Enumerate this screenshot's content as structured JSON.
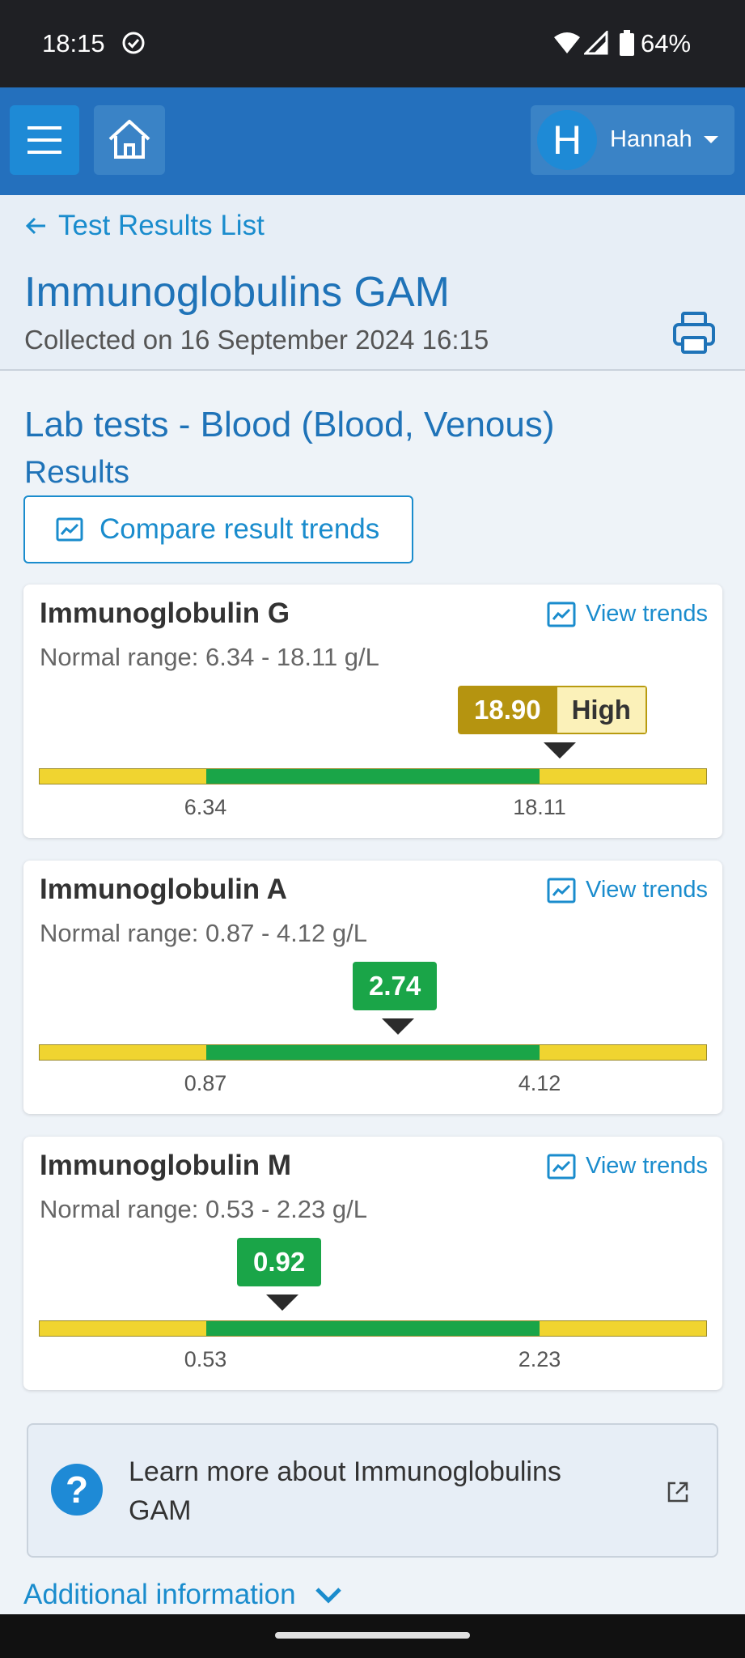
{
  "status_bar": {
    "time": "18:15",
    "battery": "64%"
  },
  "app_bar": {
    "user_initial": "H",
    "user_name": "Hannah"
  },
  "header": {
    "back_label": "Test Results List",
    "title": "Immunoglobulins GAM",
    "collected": "Collected on 16 September 2024 16:15"
  },
  "section": {
    "title": "Lab tests - Blood (Blood, Venous)",
    "subtitle": "Results",
    "compare_label": "Compare result trends"
  },
  "results": [
    {
      "name": "Immunoglobulin G",
      "trend_label": "View trends",
      "range": "Normal range: 6.34 - 18.11 g/L",
      "low": "6.34",
      "high": "18.11",
      "value": "18.90",
      "status": "High",
      "value_fraction": 0.78
    },
    {
      "name": "Immunoglobulin A",
      "trend_label": "View trends",
      "range": "Normal range: 0.87 - 4.12 g/L",
      "low": "0.87",
      "high": "4.12",
      "value": "2.74",
      "status": "",
      "value_fraction": 0.537
    },
    {
      "name": "Immunoglobulin M",
      "trend_label": "View trends",
      "range": "Normal range: 0.53 - 2.23 g/L",
      "low": "0.53",
      "high": "2.23",
      "value": "0.92",
      "status": "",
      "value_fraction": 0.364
    }
  ],
  "learn_more": {
    "text": "Learn more about Immunoglobulins GAM"
  },
  "additional_info_label": "Additional information",
  "colors": {
    "primary": "#2470bd",
    "link": "#1a8ccd",
    "normal": "#1aa548",
    "borderline": "#f0d430",
    "high": "#b59410"
  }
}
